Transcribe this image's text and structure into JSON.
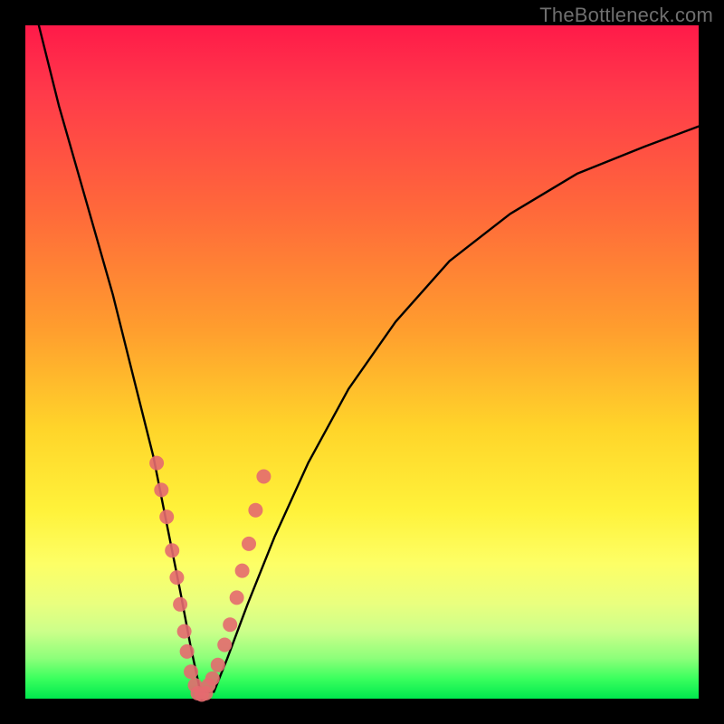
{
  "watermark": {
    "text": "TheBottleneck.com"
  },
  "chart_data": {
    "type": "line",
    "title": "",
    "xlabel": "",
    "ylabel": "",
    "xlim": [
      0,
      100
    ],
    "ylim": [
      0,
      100
    ],
    "grid": false,
    "series": [
      {
        "name": "bottleneck-curve",
        "x": [
          2,
          5,
          9,
          13,
          16,
          19,
          21,
          23,
          24.5,
          26,
          28,
          30,
          33,
          37,
          42,
          48,
          55,
          63,
          72,
          82,
          92,
          100
        ],
        "y": [
          100,
          88,
          74,
          60,
          48,
          36,
          26,
          16,
          8,
          1,
          1,
          6,
          14,
          24,
          35,
          46,
          56,
          65,
          72,
          78,
          82,
          85
        ]
      }
    ],
    "markers": [
      {
        "name": "left-branch-dots",
        "x": [
          19.5,
          20.2,
          21.0,
          21.8,
          22.5,
          23.0,
          23.6,
          24.0,
          24.6,
          25.2
        ],
        "y": [
          35.0,
          31.0,
          27.0,
          22.0,
          18.0,
          14.0,
          10.0,
          7.0,
          4.0,
          2.0
        ]
      },
      {
        "name": "right-branch-dots",
        "x": [
          27.2,
          27.8,
          28.6,
          29.6,
          30.4,
          31.4,
          32.2,
          33.2,
          34.2,
          35.4
        ],
        "y": [
          2.0,
          3.0,
          5.0,
          8.0,
          11.0,
          15.0,
          19.0,
          23.0,
          28.0,
          33.0
        ]
      },
      {
        "name": "valley-dots",
        "x": [
          25.6,
          26.2,
          26.8
        ],
        "y": [
          0.8,
          0.6,
          0.8
        ]
      }
    ],
    "colors": {
      "curve": "#000000",
      "marker": "#e46a6f"
    }
  }
}
